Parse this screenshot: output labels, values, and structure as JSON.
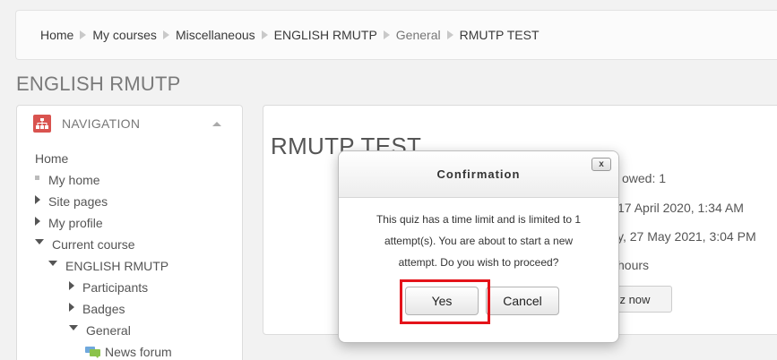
{
  "breadcrumb": [
    {
      "label": "Home",
      "muted": false
    },
    {
      "label": "My courses",
      "muted": false
    },
    {
      "label": "Miscellaneous",
      "muted": false
    },
    {
      "label": "ENGLISH RMUTP",
      "muted": false
    },
    {
      "label": "General",
      "muted": true
    },
    {
      "label": "RMUTP TEST",
      "muted": false
    }
  ],
  "course_title": "ENGLISH RMUTP",
  "navigation": {
    "header": "NAVIGATION",
    "home": "Home",
    "items": [
      {
        "label": "My home",
        "marker": "square",
        "indent": 0
      },
      {
        "label": "Site pages",
        "marker": "right",
        "indent": 0
      },
      {
        "label": "My profile",
        "marker": "right",
        "indent": 0
      },
      {
        "label": "Current course",
        "marker": "down",
        "indent": 0
      },
      {
        "label": "ENGLISH RMUTP",
        "marker": "down",
        "indent": 1
      },
      {
        "label": "Participants",
        "marker": "right",
        "indent": 2
      },
      {
        "label": "Badges",
        "marker": "right",
        "indent": 2
      },
      {
        "label": "General",
        "marker": "down",
        "indent": 2
      },
      {
        "label": "News forum",
        "marker": "forum",
        "indent": 3
      }
    ]
  },
  "main": {
    "title": "RMUTP TEST",
    "attempts_allowed": "owed: 1",
    "opened": "17 April 2020, 1:34 AM",
    "closes": "y, 27 May 2021, 3:04 PM",
    "time_limit": "hours",
    "attempt_button": "iz now"
  },
  "modal": {
    "title": "Confirmation",
    "close_label": "x",
    "message_lines": [
      "This quiz has a time limit and is limited to 1",
      "attempt(s). You are about to start a new",
      "attempt. Do you wish to proceed?"
    ],
    "yes_label": "Yes",
    "cancel_label": "Cancel"
  },
  "colors": {
    "highlight": "#e4131a",
    "nav_icon": "#d9534f"
  }
}
